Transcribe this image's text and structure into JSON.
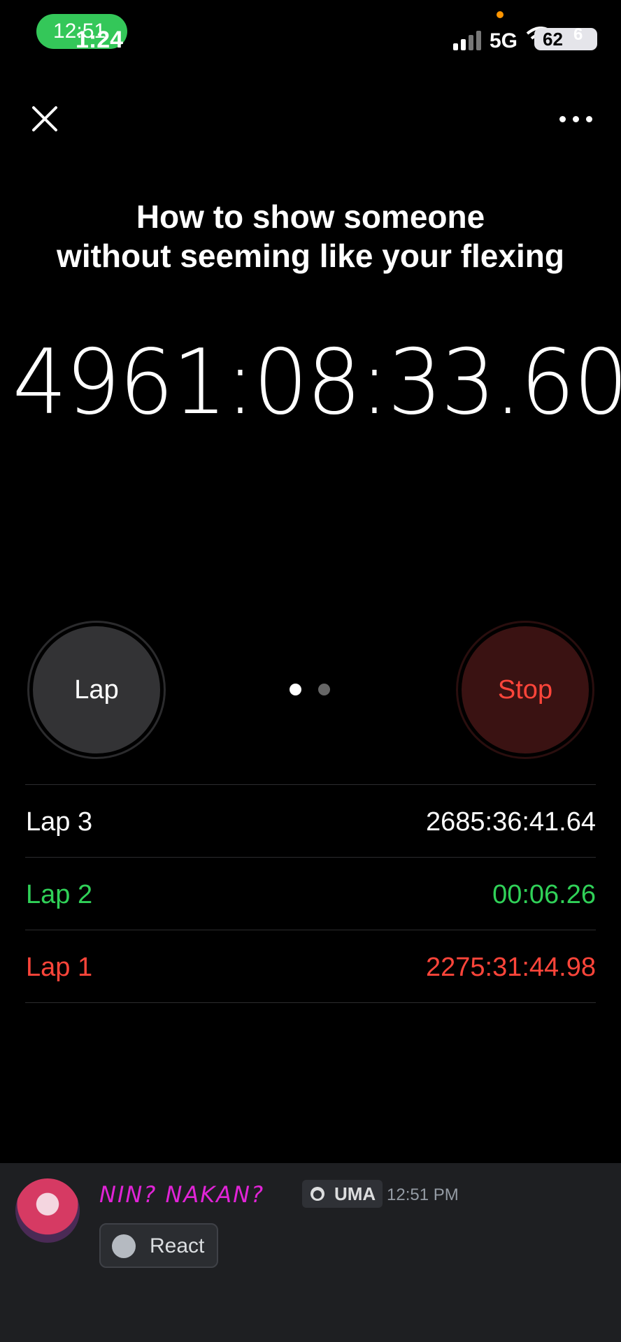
{
  "status_bar": {
    "pill_time": "12:51",
    "time": "1:24",
    "network": "5G",
    "battery": "62",
    "battery_overlay": "6",
    "colors": {
      "pill": "#34c759",
      "recording_dot": "#ff9500"
    }
  },
  "nav": {
    "close_icon": "close-icon",
    "more_icon": "ellipsis-icon"
  },
  "caption": {
    "line1": "How to show someone",
    "line2": "without seeming like your flexing"
  },
  "stopwatch": {
    "elapsed": "4961:08:33.60",
    "lap_button": "Lap",
    "stop_button": "Stop",
    "page_count": 2,
    "active_page": 1,
    "laps": [
      {
        "name": "Lap 3",
        "time": "2685:36:41.64",
        "status": "current",
        "color": "#ffffff"
      },
      {
        "name": "Lap 2",
        "time": "00:06.26",
        "status": "fastest",
        "color": "#30d158"
      },
      {
        "name": "Lap 1",
        "time": "2275:31:44.98",
        "status": "slowest",
        "color": "#ff453a"
      }
    ]
  },
  "message": {
    "username": "NIN? NAKAN?",
    "tag": "UMA",
    "timestamp": "12:51 PM",
    "react_label": "React",
    "colors": {
      "username": "#e024d6",
      "background": "#1e1f22"
    }
  }
}
